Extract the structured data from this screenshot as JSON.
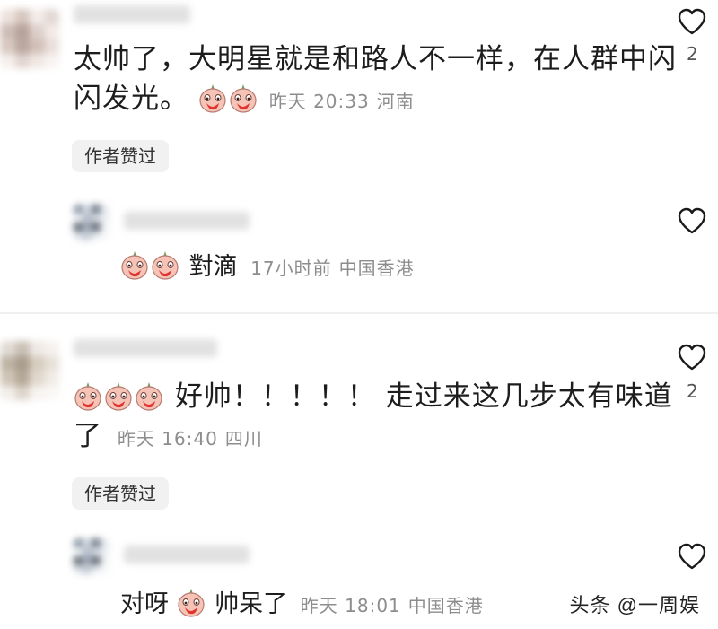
{
  "comments": [
    {
      "text_line1": "太帅了，大明星就是和路人不一样，在人群中闪",
      "text_line2": "闪发光。",
      "time": "昨天 20:33",
      "location": "河南",
      "badge": "作者赞过",
      "likes": "2",
      "reply": {
        "text": "對滴",
        "time": "17小时前",
        "location": "中国香港"
      }
    },
    {
      "text_line1": "好帅！！！！！ 走过来这几步太有味道",
      "text_line2": "了",
      "time": "昨天 16:40",
      "location": "四川",
      "badge": "作者赞过",
      "likes": "2",
      "reply": {
        "text_a": "对呀",
        "text_b": "帅呆了",
        "time": "昨天 18:01",
        "location": "中国香港"
      }
    }
  ],
  "watermark": "头条 @一周娱",
  "colors": {
    "meta": "#8d8d8d",
    "badge_bg": "#f1f1f1",
    "divider": "#f0f0f0",
    "emoji_face": "#f6c3b7",
    "emoji_hand": "#e0342f"
  },
  "icons": {
    "like": "heart-outline-icon",
    "emoji": "facepalm-emoji-icon"
  }
}
